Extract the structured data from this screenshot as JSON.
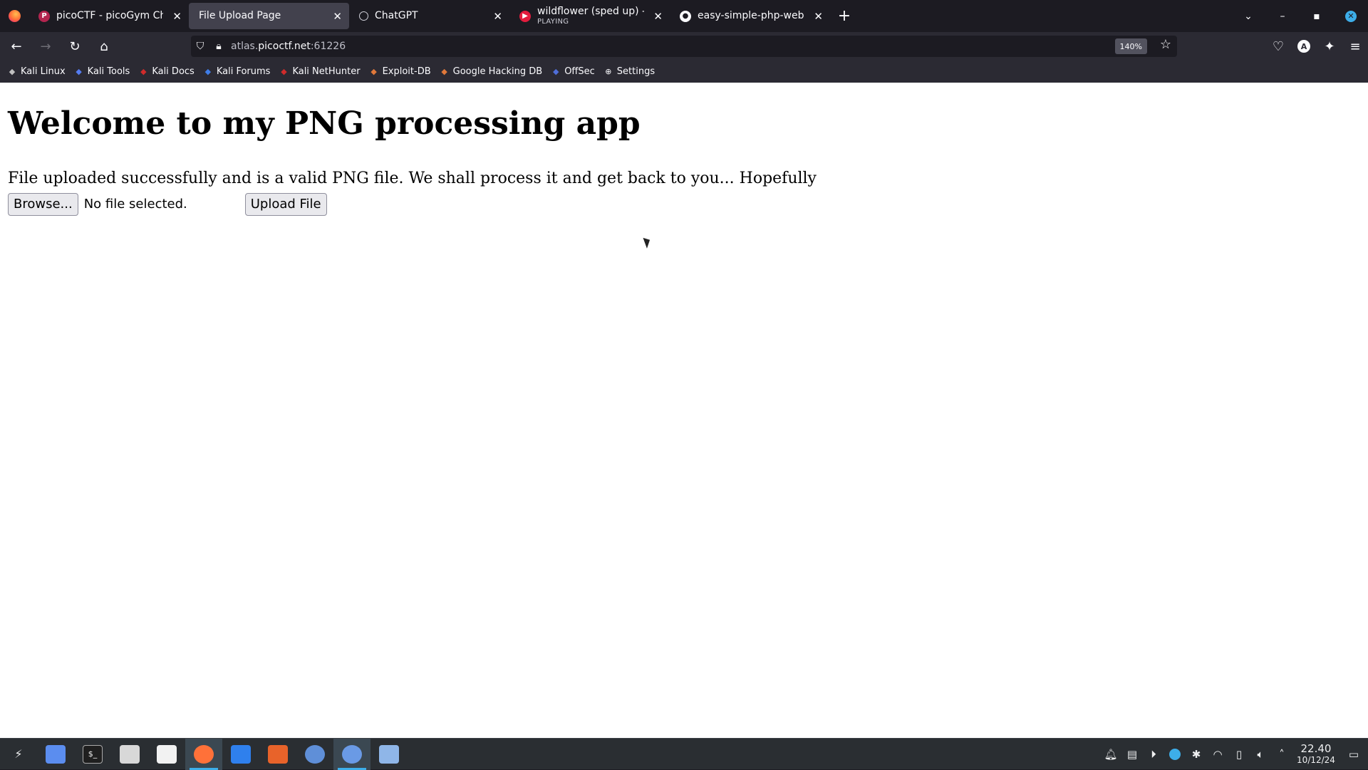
{
  "tabs": [
    {
      "title": "picoCTF - picoGym Challen",
      "subtitle": "",
      "favicon": "picoctf-icon",
      "color": "#b3254f",
      "active": false
    },
    {
      "title": "File Upload Page",
      "subtitle": "",
      "favicon": "",
      "color": "",
      "active": true
    },
    {
      "title": "ChatGPT",
      "subtitle": "",
      "favicon": "chatgpt-icon",
      "color": "#6e6d75",
      "active": false
    },
    {
      "title": "wildflower (sped up) - YouT",
      "subtitle": "PLAYING",
      "favicon": "youtube-icon",
      "color": "#e31c3d",
      "active": false
    },
    {
      "title": "easy-simple-php-webshell.",
      "subtitle": "",
      "favicon": "github-icon",
      "color": "#fbfbfe",
      "active": false
    }
  ],
  "url": {
    "prefix": "atlas.",
    "host": "picoctf.net",
    "suffix": ":61226"
  },
  "zoom": "140%",
  "bookmarks": [
    {
      "label": "Kali Linux",
      "icon": "kali-dragon-icon",
      "color": "#c0c0c0"
    },
    {
      "label": "Kali Tools",
      "icon": "kali-tools-icon",
      "color": "#557cf0"
    },
    {
      "label": "Kali Docs",
      "icon": "kali-docs-icon",
      "color": "#d02b2b"
    },
    {
      "label": "Kali Forums",
      "icon": "kali-forums-icon",
      "color": "#3f7de8"
    },
    {
      "label": "Kali NetHunter",
      "icon": "nethunter-icon",
      "color": "#d02b2b"
    },
    {
      "label": "Exploit-DB",
      "icon": "exploitdb-icon",
      "color": "#e0783a"
    },
    {
      "label": "Google Hacking DB",
      "icon": "ghdb-icon",
      "color": "#e0783a"
    },
    {
      "label": "OffSec",
      "icon": "offsec-icon",
      "color": "#4f6ed8"
    },
    {
      "label": "Settings",
      "icon": "globe-icon",
      "color": "#fbfbfe"
    }
  ],
  "page": {
    "heading": "Welcome to my PNG processing app",
    "message": "File uploaded successfully and is a valid PNG file. We shall process it and get back to you... Hopefully",
    "browse_label": "Browse...",
    "file_status": "No file selected.",
    "upload_label": "Upload File"
  },
  "taskbar": {
    "time": "22.40",
    "date": "10/12/24",
    "apps": [
      {
        "name": "kali-menu-icon",
        "color": "#eff0f1",
        "active": false
      },
      {
        "name": "workspace-icon",
        "color": "#5b8def",
        "active": false
      },
      {
        "name": "terminal-icon",
        "color": "#1f1f1f",
        "active": false
      },
      {
        "name": "files-icon",
        "color": "#d8d8d8",
        "active": false
      },
      {
        "name": "text-editor-icon",
        "color": "#f2f2f2",
        "active": false
      },
      {
        "name": "firefox-icon",
        "color": "#ff7139",
        "active": true
      },
      {
        "name": "vscode-icon",
        "color": "#2f80ed",
        "active": false
      },
      {
        "name": "burpsuite-icon",
        "color": "#e8632a",
        "active": false
      },
      {
        "name": "chromium-icon",
        "color": "#5f8fd8",
        "active": false
      },
      {
        "name": "chrome-icon",
        "color": "#6a9ae5",
        "active": true
      },
      {
        "name": "network-tool-icon",
        "color": "#8fb6e8",
        "active": false
      }
    ]
  }
}
